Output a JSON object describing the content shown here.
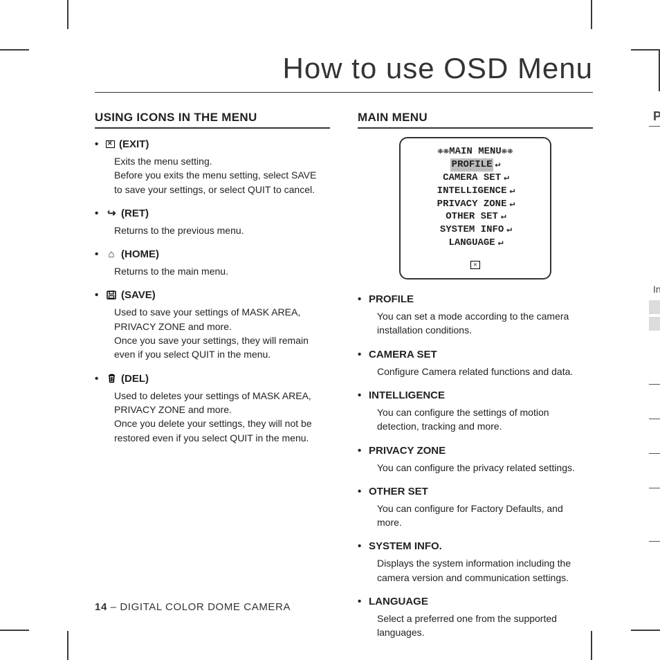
{
  "title": "How to use OSD Menu",
  "left": {
    "heading": "USING ICONS IN THE MENU",
    "items": [
      {
        "icon": "exit-icon",
        "label": "(EXIT)",
        "desc": "Exits the menu setting.\nBefore you exits the menu setting, select SAVE to save your settings, or select QUIT to cancel."
      },
      {
        "icon": "return-icon",
        "label": "(RET)",
        "desc": "Returns to the previous menu."
      },
      {
        "icon": "home-icon",
        "label": "(HOME)",
        "desc": "Returns to the main menu."
      },
      {
        "icon": "save-icon",
        "label": "(SAVE)",
        "desc": "Used to save your settings of MASK AREA, PRIVACY ZONE and more.\nOnce you save your settings, they will remain even if you select QUIT in the menu."
      },
      {
        "icon": "delete-icon",
        "label": "(DEL)",
        "desc": "Used to deletes your settings of MASK AREA, PRIVACY ZONE and more.\nOnce you delete your settings, they will not be restored even if you select QUIT in the menu."
      }
    ]
  },
  "right": {
    "heading": "MAIN MENU",
    "osd": {
      "title": "❋❋MAIN MENU❋❋",
      "rows": [
        {
          "text": "PROFILE",
          "selected": true
        },
        {
          "text": "CAMERA SET"
        },
        {
          "text": "INTELLIGENCE"
        },
        {
          "text": "PRIVACY ZONE"
        },
        {
          "text": "OTHER SET"
        },
        {
          "text": "SYSTEM INFO"
        },
        {
          "text": "LANGUAGE"
        }
      ]
    },
    "items": [
      {
        "label": "PROFILE",
        "desc": "You can set a mode according to the camera installation conditions."
      },
      {
        "label": "CAMERA SET",
        "desc": "Configure Camera related functions and data."
      },
      {
        "label": "INTELLIGENCE",
        "desc": "You can configure the settings of motion detection, tracking and more."
      },
      {
        "label": "PRIVACY ZONE",
        "desc": "You can configure the privacy related settings."
      },
      {
        "label": "OTHER SET",
        "desc": "You can configure for Factory Defaults, and more."
      },
      {
        "label": "SYSTEM INFO.",
        "desc": "Displays the system information including the camera version and communication settings."
      },
      {
        "label": "LANGUAGE",
        "desc": "Select a preferred one from the supported languages."
      }
    ]
  },
  "footer": {
    "page": "14",
    "text": " – DIGITAL COLOR DOME CAMERA"
  },
  "edge": {
    "p": "P",
    "i": "In"
  }
}
